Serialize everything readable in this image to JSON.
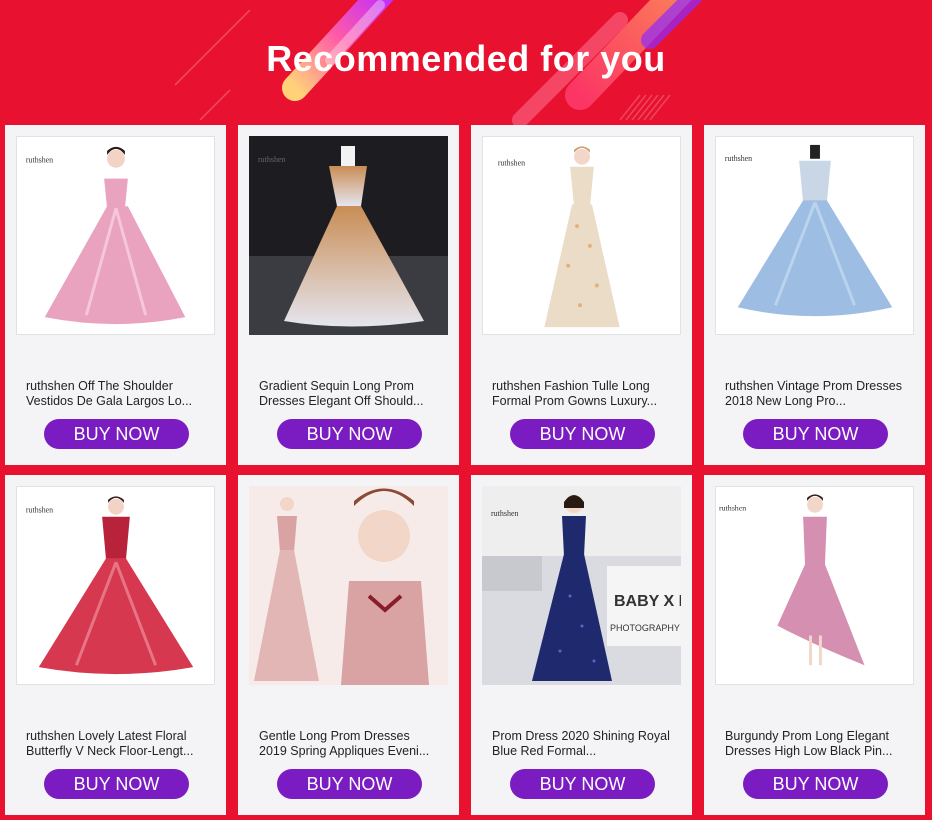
{
  "header": {
    "title": "Recommended for you"
  },
  "products": [
    {
      "brand": "ruthshen",
      "title": "ruthshen Off The Shoulder Vestidos De Gala Largos Lo...",
      "button": "BUY NOW",
      "image": "pink-ball-gown",
      "dress_color": "#e9a3be"
    },
    {
      "brand": "ruthshen",
      "title": "Gradient Sequin Long Prom Dresses Elegant Off Should...",
      "button": "BUY NOW",
      "image": "gradient-sequin-gown",
      "dress_color": "#c99a6a"
    },
    {
      "brand": "ruthshen",
      "title": "ruthshen Fashion Tulle Long Formal Prom Gowns Luxury...",
      "button": "BUY NOW",
      "image": "floral-tulle-gown",
      "dress_color": "#eadcc6"
    },
    {
      "brand": "ruthshen",
      "title": "ruthshen Vintage Prom Dresses 2018 New Long Pro...",
      "button": "BUY NOW",
      "image": "blue-ball-gown",
      "dress_color": "#9dbde2"
    },
    {
      "brand": "ruthshen",
      "title": "ruthshen Lovely Latest Floral Butterfly V Neck Floor-Lengt...",
      "button": "BUY NOW",
      "image": "red-ball-gown",
      "dress_color": "#d6394f"
    },
    {
      "brand": "",
      "title": "Gentle Long Prom Dresses 2019 Spring Appliques Eveni...",
      "button": "BUY NOW",
      "image": "blush-appliques-gown",
      "dress_color": "#d9a3a4"
    },
    {
      "brand": "ruthshen",
      "title": "Prom Dress 2020 Shining Royal Blue Red Formal...",
      "button": "BUY NOW",
      "image": "royal-blue-gown",
      "dress_color": "#1f2a6e"
    },
    {
      "brand": "ruthshen",
      "title": "Burgundy Prom Long Elegant Dresses High Low Black Pin...",
      "button": "BUY NOW",
      "image": "pink-high-low-dress",
      "dress_color": "#d58fb0"
    }
  ]
}
